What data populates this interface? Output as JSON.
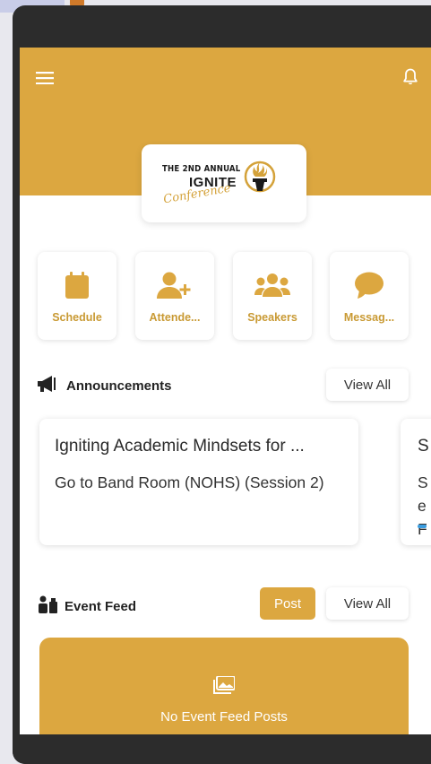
{
  "logo": {
    "line1": "THE 2ND ANNUAL",
    "line2": "IGNITE",
    "script": "Conference"
  },
  "tiles": [
    {
      "label": "Schedule",
      "icon": "calendar-icon"
    },
    {
      "label": "Attende...",
      "icon": "add-person-icon"
    },
    {
      "label": "Speakers",
      "icon": "people-group-icon"
    },
    {
      "label": "Messag...",
      "icon": "chat-bubble-icon"
    }
  ],
  "announcements": {
    "title": "Announcements",
    "view_all": "View All",
    "items": [
      {
        "title": "Igniting Academic Mindsets for ...",
        "subtitle": "Go to Band Room (NOHS) (Session 2)"
      },
      {
        "title": "S",
        "subtitle": "Se Fl"
      }
    ]
  },
  "event_feed": {
    "title": "Event Feed",
    "post_label": "Post",
    "view_all": "View All",
    "empty_text": "No Event Feed Posts"
  },
  "colors": {
    "brand_gold": "#dca740",
    "tile_label_gold": "#c99a34",
    "frame_dark": "#2c2c2c"
  }
}
